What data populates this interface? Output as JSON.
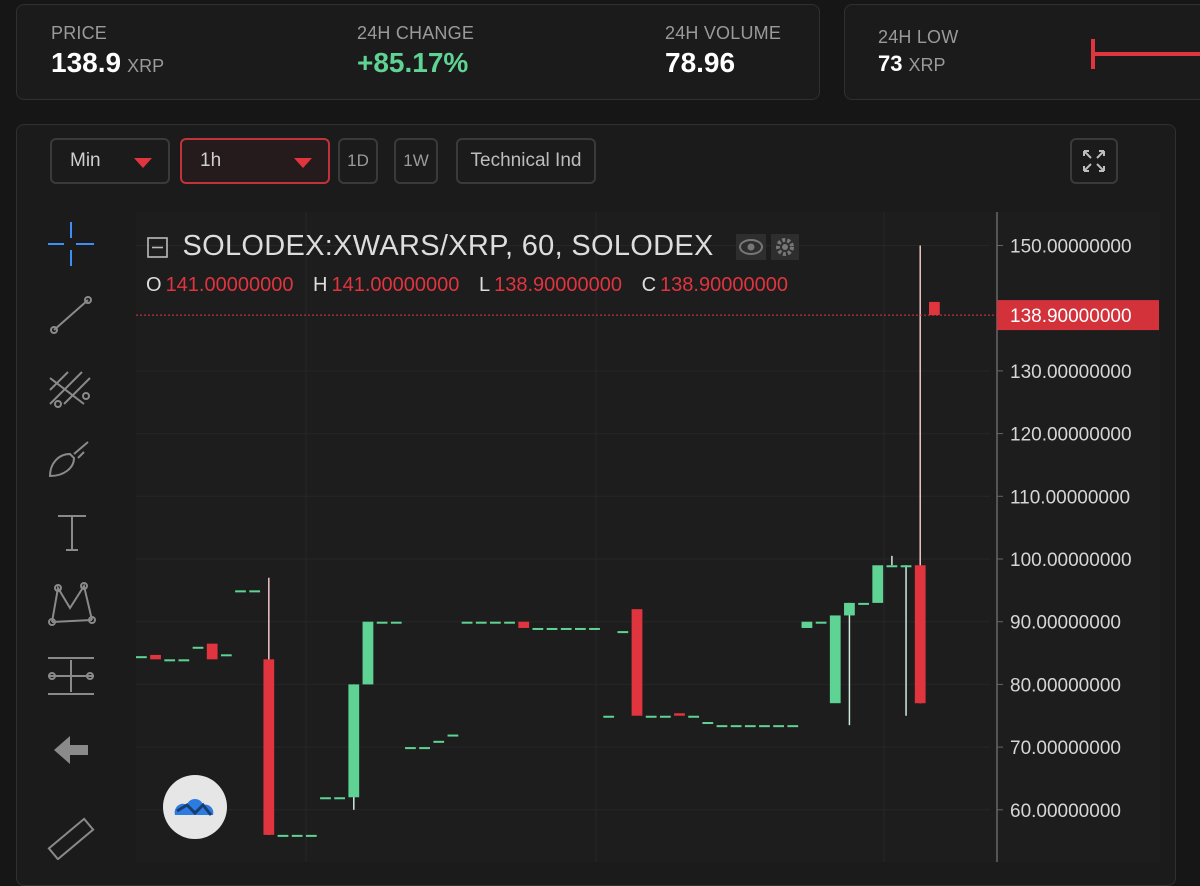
{
  "stats": {
    "price_label": "PRICE",
    "price_value": "138.9",
    "price_unit": "XRP",
    "change_label": "24H CHANGE",
    "change_value": "+85.17%",
    "volume_label": "24H VOLUME",
    "volume_value": "78.96",
    "low_label": "24H LOW",
    "low_value": "73",
    "low_unit": "XRP"
  },
  "toolbar": {
    "interval_unit": "Min",
    "resolution": "1h",
    "btn_1d": "1D",
    "btn_1w": "1W",
    "indicators": "Technical Ind"
  },
  "legend": {
    "symbol": "SOLODEX:XWARS/XRP, 60, SOLODEX",
    "o_key": "O",
    "o_val": "141.00000000",
    "h_key": "H",
    "h_val": "141.00000000",
    "l_key": "L",
    "l_val": "138.90000000",
    "c_key": "C",
    "c_val": "138.90000000"
  },
  "colors": {
    "up": "#5fd394",
    "down": "#e0343f",
    "background": "#161616",
    "panel": "#1b1b1b"
  },
  "icons": [
    "crosshair-icon",
    "trend-line-icon",
    "fib-tool-icon",
    "brush-icon",
    "text-icon",
    "pattern-icon",
    "measure-icon",
    "back-arrow-icon",
    "ruler-icon",
    "tradingview-logo-icon",
    "fullscreen-icon",
    "eye-icon",
    "gear-icon"
  ],
  "chart_data": {
    "type": "candlestick",
    "symbol": "SOLODEX:XWARS/XRP",
    "interval": "60",
    "last_price": 138.9,
    "last_price_label": "138.90000000",
    "ylim": [
      55,
      152
    ],
    "y_ticks": [
      {
        "value": 150,
        "label": "150.00000000"
      },
      {
        "value": 130,
        "label": "130.00000000"
      },
      {
        "value": 120,
        "label": "120.00000000"
      },
      {
        "value": 110,
        "label": "110.00000000"
      },
      {
        "value": 100,
        "label": "100.00000000"
      },
      {
        "value": 90,
        "label": "90.00000000"
      },
      {
        "value": 80,
        "label": "80.00000000"
      },
      {
        "value": 70,
        "label": "70.00000000"
      },
      {
        "value": 60,
        "label": "60.00000000"
      }
    ],
    "candles": [
      {
        "o": 84.5,
        "h": 84.5,
        "l": 84.5,
        "c": 84.5
      },
      {
        "o": 84.7,
        "h": 84.7,
        "l": 84,
        "c": 84
      },
      {
        "o": 84,
        "h": 84,
        "l": 84,
        "c": 84
      },
      {
        "o": 84,
        "h": 84,
        "l": 84,
        "c": 84
      },
      {
        "o": 86,
        "h": 86,
        "l": 86,
        "c": 86
      },
      {
        "o": 86.5,
        "h": 86.5,
        "l": 84,
        "c": 84
      },
      {
        "o": 84.8,
        "h": 84.8,
        "l": 84.8,
        "c": 84.8
      },
      {
        "o": 95,
        "h": 95,
        "l": 95,
        "c": 95
      },
      {
        "o": 95,
        "h": 95,
        "l": 95,
        "c": 95
      },
      {
        "o": 84,
        "h": 97,
        "l": 56,
        "c": 56
      },
      {
        "o": 56,
        "h": 56,
        "l": 56,
        "c": 56
      },
      {
        "o": 56,
        "h": 56,
        "l": 56,
        "c": 56
      },
      {
        "o": 56,
        "h": 56,
        "l": 56,
        "c": 56
      },
      {
        "o": 62,
        "h": 62,
        "l": 62,
        "c": 62
      },
      {
        "o": 62,
        "h": 62,
        "l": 62,
        "c": 62
      },
      {
        "o": 62,
        "h": 80,
        "l": 60,
        "c": 80
      },
      {
        "o": 80,
        "h": 90,
        "l": 80,
        "c": 90
      },
      {
        "o": 90,
        "h": 90,
        "l": 90,
        "c": 90
      },
      {
        "o": 90,
        "h": 90,
        "l": 90,
        "c": 90
      },
      {
        "o": 70,
        "h": 70,
        "l": 70,
        "c": 70
      },
      {
        "o": 70,
        "h": 70,
        "l": 70,
        "c": 70
      },
      {
        "o": 71,
        "h": 71,
        "l": 71,
        "c": 71
      },
      {
        "o": 72,
        "h": 72,
        "l": 72,
        "c": 72
      },
      {
        "o": 90,
        "h": 90,
        "l": 90,
        "c": 90
      },
      {
        "o": 90,
        "h": 90,
        "l": 90,
        "c": 90
      },
      {
        "o": 90,
        "h": 90,
        "l": 90,
        "c": 90
      },
      {
        "o": 90,
        "h": 90,
        "l": 90,
        "c": 90
      },
      {
        "o": 90,
        "h": 90,
        "l": 89,
        "c": 89
      },
      {
        "o": 89,
        "h": 89,
        "l": 89,
        "c": 89
      },
      {
        "o": 89,
        "h": 89,
        "l": 89,
        "c": 89
      },
      {
        "o": 89,
        "h": 89,
        "l": 89,
        "c": 89
      },
      {
        "o": 89,
        "h": 89,
        "l": 89,
        "c": 89
      },
      {
        "o": 89,
        "h": 89,
        "l": 89,
        "c": 89
      },
      {
        "o": 75,
        "h": 75,
        "l": 75,
        "c": 75
      },
      {
        "o": 88.5,
        "h": 88.5,
        "l": 88.5,
        "c": 88.5
      },
      {
        "o": 92,
        "h": 92,
        "l": 75,
        "c": 75
      },
      {
        "o": 75,
        "h": 75,
        "l": 75,
        "c": 75
      },
      {
        "o": 75,
        "h": 75,
        "l": 75,
        "c": 75
      },
      {
        "o": 75.4,
        "h": 75.4,
        "l": 75,
        "c": 75
      },
      {
        "o": 75,
        "h": 75,
        "l": 75,
        "c": 75
      },
      {
        "o": 74,
        "h": 74,
        "l": 74,
        "c": 74
      },
      {
        "o": 73.5,
        "h": 73.5,
        "l": 73.5,
        "c": 73.5
      },
      {
        "o": 73.5,
        "h": 73.5,
        "l": 73.5,
        "c": 73.5
      },
      {
        "o": 73.5,
        "h": 73.5,
        "l": 73.5,
        "c": 73.5
      },
      {
        "o": 73.5,
        "h": 73.5,
        "l": 73.5,
        "c": 73.5
      },
      {
        "o": 73.5,
        "h": 73.5,
        "l": 73.5,
        "c": 73.5
      },
      {
        "o": 73.5,
        "h": 73.5,
        "l": 73.5,
        "c": 73.5
      },
      {
        "o": 89,
        "h": 90,
        "l": 89,
        "c": 90
      },
      {
        "o": 90,
        "h": 90,
        "l": 90,
        "c": 90
      },
      {
        "o": 77,
        "h": 91,
        "l": 77,
        "c": 91
      },
      {
        "o": 91,
        "h": 93,
        "l": 73.5,
        "c": 93
      },
      {
        "o": 93,
        "h": 93,
        "l": 93,
        "c": 93
      },
      {
        "o": 93,
        "h": 99,
        "l": 93,
        "c": 99
      },
      {
        "o": 99,
        "h": 100.5,
        "l": 99,
        "c": 99
      },
      {
        "o": 99,
        "h": 99,
        "l": 75,
        "c": 99
      },
      {
        "o": 99,
        "h": 150,
        "l": 77,
        "c": 77
      },
      {
        "o": 141,
        "h": 141,
        "l": 138.9,
        "c": 138.9
      }
    ]
  }
}
